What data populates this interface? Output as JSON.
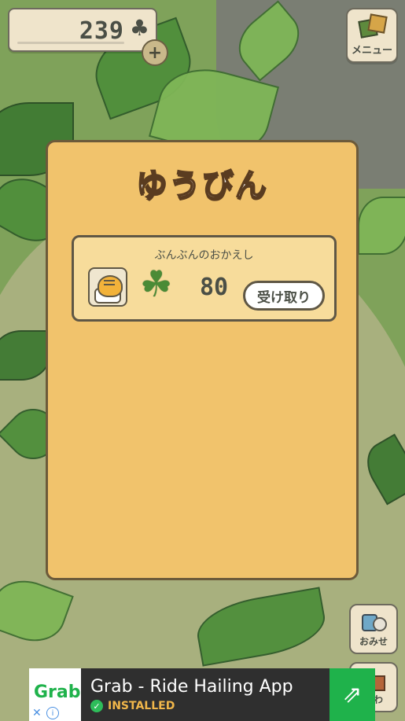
{
  "header": {
    "currency_amount": "239",
    "currency_icon": "clover-icon",
    "plus_symbol": "+",
    "menu_label": "メニュー"
  },
  "dialog": {
    "title": "ゆうびん",
    "mail": {
      "sender": "ぶんぶんのおかえし",
      "reward_icon": "clover-icon",
      "reward_amount": "80",
      "receive_label": "受け取り"
    }
  },
  "side_buttons": {
    "shop_label": "おみせ",
    "home_label": "にわ"
  },
  "ad": {
    "logo_text": "Grab",
    "title": "Grab - Ride Hailing App",
    "status": "INSTALLED",
    "close_symbol": "✕",
    "info_symbol": "i"
  },
  "colors": {
    "dialog_bg": "#f1c36c",
    "card_bg": "#f7dc9b",
    "clover_green": "#4a8b36",
    "ad_accent": "#1fb24b"
  }
}
